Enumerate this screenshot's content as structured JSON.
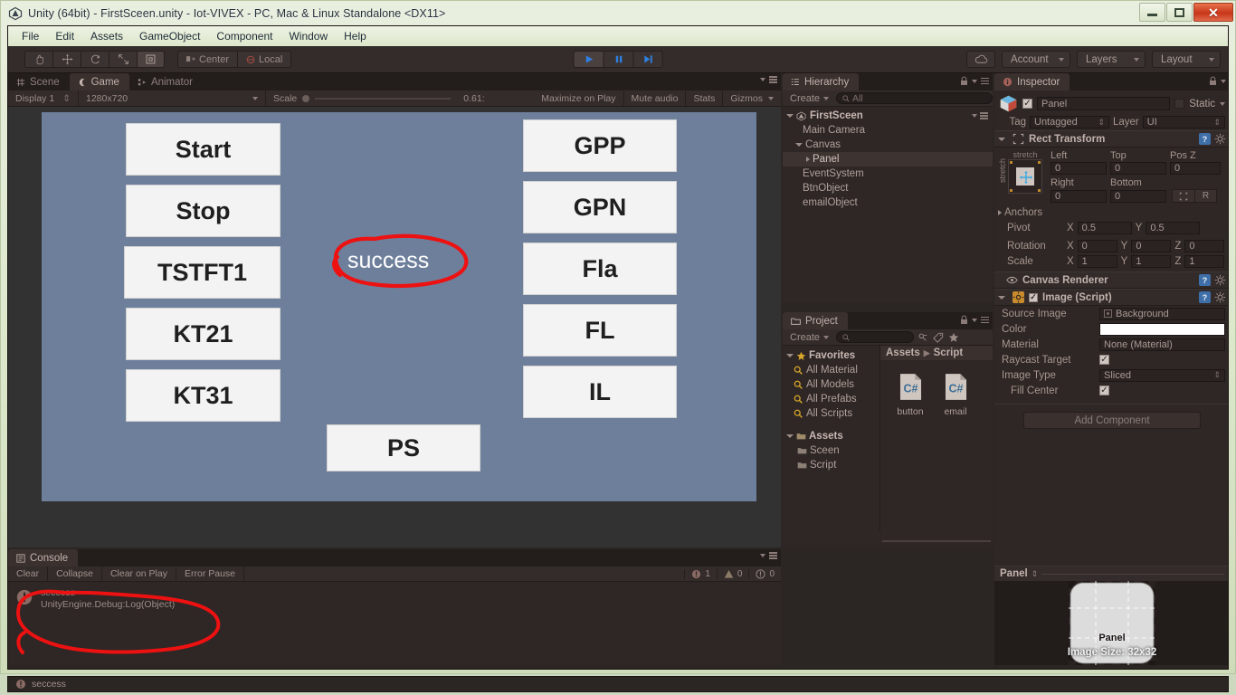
{
  "window": {
    "title": "Unity (64bit) - FirstSceen.unity - Iot-VIVEX - PC, Mac & Linux Standalone <DX11>",
    "minimize_label": "",
    "maximize_label": "",
    "close_label": "✕"
  },
  "menubar": {
    "items": [
      "File",
      "Edit",
      "Assets",
      "GameObject",
      "Component",
      "Window",
      "Help"
    ]
  },
  "toolbar": {
    "transform_tools": [
      "hand-tool",
      "move-tool",
      "rotate-tool",
      "scale-tool",
      "rect-tool"
    ],
    "pivot_mode": "Center",
    "pivot_rotation": "Local",
    "play_controls": [
      "play",
      "pause",
      "step"
    ],
    "cloud_label": "",
    "account_label": "Account",
    "layers_label": "Layers",
    "layout_label": "Layout"
  },
  "gameview": {
    "tabs": [
      {
        "label": "Scene",
        "icon": "grid-icon",
        "active": false
      },
      {
        "label": "Game",
        "icon": "gamepad-icon",
        "active": true
      },
      {
        "label": "Animator",
        "icon": "animator-icon",
        "active": false
      }
    ],
    "display": "Display 1",
    "resolution": "1280x720",
    "scale_label": "Scale",
    "scale_value": "0.61:",
    "maximize_on_play": "Maximize on Play",
    "mute_audio": "Mute audio",
    "stats": "Stats",
    "gizmos": "Gizmos",
    "panel_color": "#6e7f9b",
    "left_buttons": [
      "Start",
      "Stop",
      "TSTFT1",
      "KT21",
      "KT31"
    ],
    "right_buttons": [
      "GPP",
      "GPN",
      "Fla",
      "FL",
      "IL"
    ],
    "center_button": "PS",
    "status_text": "success",
    "annotation_color": "#ee1111"
  },
  "hierarchy": {
    "tab_label": "Hierarchy",
    "create_label": "Create",
    "search_placeholder": "All",
    "scene_name": "FirstSceen",
    "items": [
      {
        "label": "Main Camera",
        "depth": 1,
        "expander": "none",
        "selected": false
      },
      {
        "label": "Canvas",
        "depth": 1,
        "expander": "open",
        "selected": false
      },
      {
        "label": "Panel",
        "depth": 2,
        "expander": "closed",
        "selected": true
      },
      {
        "label": "EventSystem",
        "depth": 1,
        "expander": "none",
        "selected": false
      },
      {
        "label": "BtnObject",
        "depth": 1,
        "expander": "none",
        "selected": false
      },
      {
        "label": "emailObject",
        "depth": 1,
        "expander": "none",
        "selected": false
      }
    ]
  },
  "project": {
    "tab_label": "Project",
    "create_label": "Create",
    "search_placeholder": "",
    "favorites_label": "Favorites",
    "favorites": [
      "All Material",
      "All Models",
      "All Prefabs",
      "All Scripts"
    ],
    "assets_label": "Assets",
    "assets_folders": [
      "Sceen",
      "Script"
    ],
    "breadcrumb": [
      "Assets",
      "Script"
    ],
    "files": [
      {
        "name": "button",
        "type": "C#"
      },
      {
        "name": "email",
        "type": "C#"
      }
    ]
  },
  "console": {
    "tab_label": "Console",
    "buttons": [
      "Clear",
      "Collapse",
      "Clear on Play",
      "Error Pause"
    ],
    "counts": {
      "errors": "1",
      "warnings": "0",
      "logs": "0"
    },
    "entries": [
      {
        "message": "seccess",
        "trace": "UnityEngine.Debug:Log(Object)"
      }
    ]
  },
  "inspector": {
    "tab_label": "Inspector",
    "object_name": "Panel",
    "enabled": true,
    "static_label": "Static",
    "tag_label": "Tag",
    "tag_value": "Untagged",
    "layer_label": "Layer",
    "layer_value": "UI",
    "rect_transform": {
      "title": "Rect Transform",
      "anchor_preset": "stretch",
      "anchor_preset_vertical": "stretch",
      "left_label": "Left",
      "left_value": "0",
      "top_label": "Top",
      "top_value": "0",
      "posz_label": "Pos Z",
      "posz_value": "0",
      "right_label": "Right",
      "right_value": "0",
      "bottom_label": "Bottom",
      "bottom_value": "0",
      "blueprint_label": "R",
      "anchors_label": "Anchors",
      "pivot_label": "Pivot",
      "pivot_x": "0.5",
      "pivot_y": "0.5",
      "rotation_label": "Rotation",
      "rot_x": "0",
      "rot_y": "0",
      "rot_z": "0",
      "scale_label": "Scale",
      "scale_x": "1",
      "scale_y": "1",
      "scale_z": "1"
    },
    "canvas_renderer": {
      "title": "Canvas Renderer"
    },
    "image_script": {
      "title": "Image (Script)",
      "enabled": true,
      "source_image_label": "Source Image",
      "source_image_value": "Background",
      "color_label": "Color",
      "color_value": "#ffffff",
      "material_label": "Material",
      "material_value": "None (Material)",
      "raycast_label": "Raycast Target",
      "raycast_value": true,
      "image_type_label": "Image Type",
      "image_type_value": "Sliced",
      "fill_center_label": "Fill Center",
      "fill_center_value": true
    },
    "add_component_label": "Add Component",
    "preview": {
      "title": "Panel",
      "overlay_name": "Panel",
      "size_text": "Image Size: 32x32"
    }
  },
  "statusbar": {
    "message": "seccess"
  }
}
